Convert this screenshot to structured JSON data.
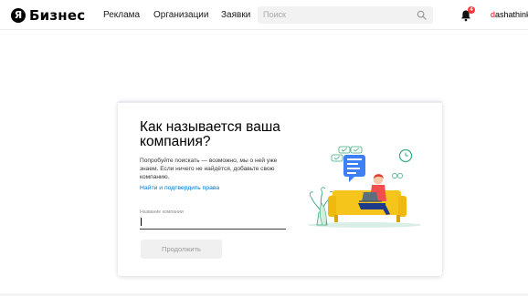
{
  "header": {
    "logo_letter": "Я",
    "logo_text": "Бизнес",
    "nav": [
      "Реклама",
      "Организации",
      "Заявки"
    ],
    "search": {
      "placeholder": "Поиск"
    },
    "notifications": {
      "count": "4"
    },
    "user": {
      "first_letter": "d",
      "rest": "ashathinks"
    }
  },
  "card": {
    "title": "Как называется ваша компания?",
    "description": "Попробуйте поискать — возможно, мы о ней уже знаем. Если ничего не найдётся, добавьте свою компанию.",
    "link": "Найти и подтвердить права",
    "field": {
      "label": "Название компании",
      "value": ""
    },
    "submit_label": "Продолжить"
  },
  "colors": {
    "accent_link": "#0077cc",
    "badge": "#ff3333",
    "sofa": "#f5c51b",
    "username_first": "#ff0000"
  }
}
